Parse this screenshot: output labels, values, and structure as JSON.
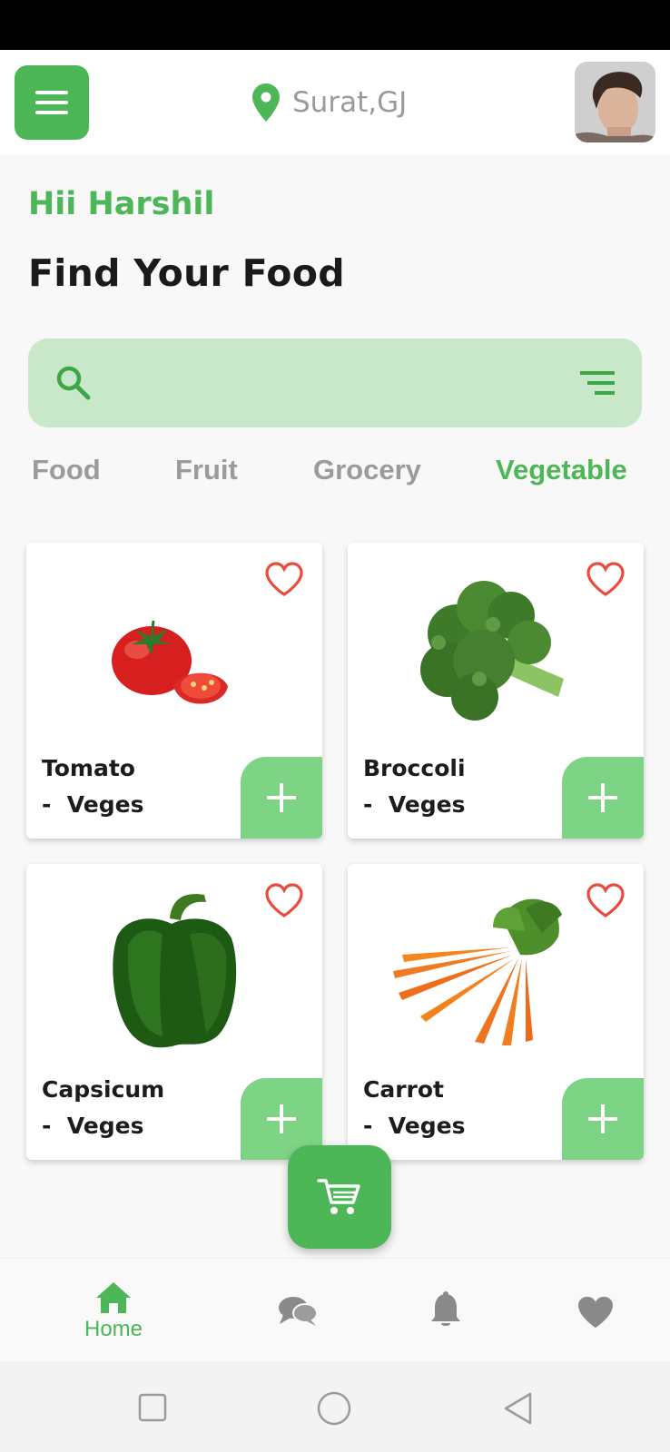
{
  "header": {
    "menu_icon": "hamburger-menu-icon",
    "location_icon": "map-pin-icon",
    "location": "Surat,GJ",
    "avatar": "profile-avatar"
  },
  "greeting": "Hii Harshil",
  "headline": "Find Your Food",
  "search": {
    "placeholder": "",
    "search_icon": "search-icon",
    "filter_icon": "filter-icon"
  },
  "tabs": [
    {
      "label": "Food",
      "active": false
    },
    {
      "label": "Fruit",
      "active": false
    },
    {
      "label": "Grocery",
      "active": false
    },
    {
      "label": "Vegetable",
      "active": true
    }
  ],
  "products": [
    {
      "name": "Tomato",
      "category": "-  Veges",
      "image": "tomato-image"
    },
    {
      "name": "Broccoli",
      "category": "-  Veges",
      "image": "broccoli-image"
    },
    {
      "name": "Capsicum",
      "category": "-  Veges",
      "image": "capsicum-image"
    },
    {
      "name": "Carrot",
      "category": "-  Veges",
      "image": "carrot-image"
    }
  ],
  "cart_icon": "cart-icon",
  "bottom_nav": [
    {
      "label": "Home",
      "icon": "home-icon",
      "active": true
    },
    {
      "label": "",
      "icon": "chat-icon",
      "active": false
    },
    {
      "label": "",
      "icon": "bell-icon",
      "active": false
    },
    {
      "label": "",
      "icon": "heart-icon",
      "active": false
    }
  ],
  "colors": {
    "accent": "#4db657",
    "accent_light": "#7ed485",
    "search_bg": "#c8e8c9",
    "heart": "#e84c3d",
    "inactive": "#9b9b9b"
  }
}
